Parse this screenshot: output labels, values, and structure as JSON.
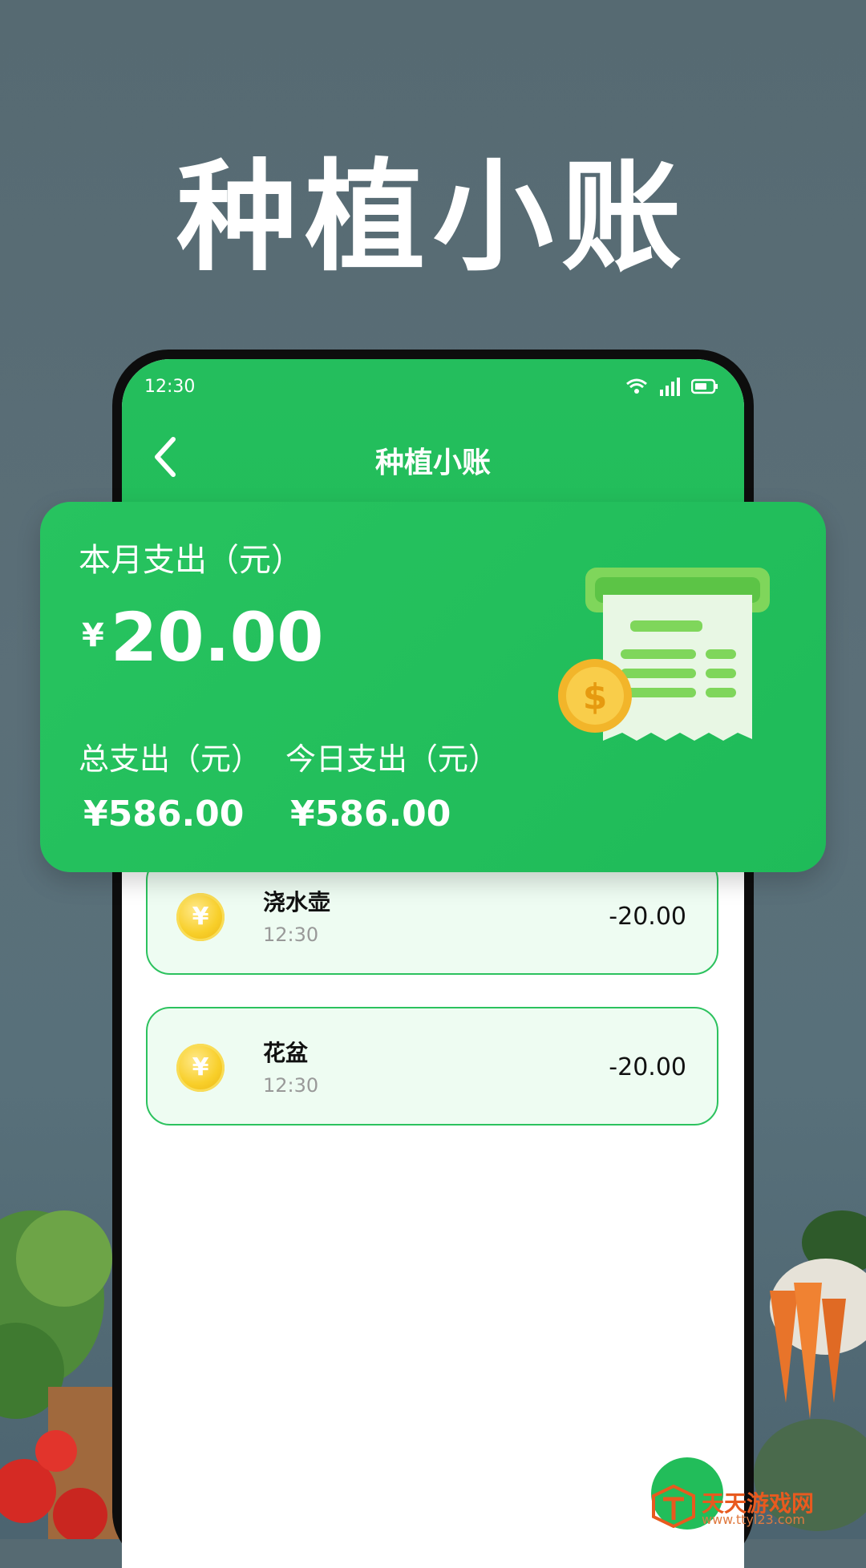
{
  "promo": {
    "headline": "种植小账",
    "watermark_site": "天天游戏网",
    "watermark_url": "www.ttyl23.com"
  },
  "status_bar": {
    "time": "12:30",
    "icons": [
      "wifi-icon",
      "signal-icon",
      "battery-icon"
    ]
  },
  "nav": {
    "title": "种植小账",
    "back_icon": "chevron-left-icon"
  },
  "summary": {
    "month_label": "本月支出（元）",
    "month_currency": "¥",
    "month_amount": "20.00",
    "total_label": "总支出（元）",
    "total_value": "¥586.00",
    "today_label": "今日支出（元）",
    "today_value": "¥586.00",
    "illustration": "receipt-with-coin-illustration"
  },
  "records": [
    {
      "name": "浇水壶",
      "time": "12:30",
      "amount": "-20.00",
      "icon": "yen-coin-icon",
      "coin_symbol": "¥"
    },
    {
      "name": "花盆",
      "time": "12:30",
      "amount": "-20.00",
      "icon": "yen-coin-icon",
      "coin_symbol": "¥"
    }
  ],
  "colors": {
    "primary_green": "#22bd5a",
    "row_background": "#eefcf2",
    "row_border": "#2cc25e",
    "coin_gold": "#f8cf2a",
    "page_background": "#566a72"
  }
}
